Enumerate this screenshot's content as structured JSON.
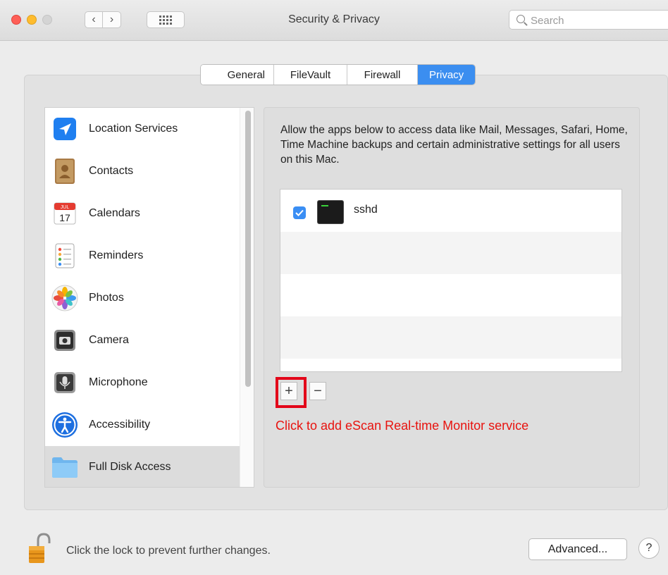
{
  "window": {
    "title": "Security & Privacy",
    "search_placeholder": "Search"
  },
  "tabs": [
    {
      "label": "General",
      "active": false
    },
    {
      "label": "FileVault",
      "active": false
    },
    {
      "label": "Firewall",
      "active": false
    },
    {
      "label": "Privacy",
      "active": true
    }
  ],
  "sidebar": {
    "items": [
      {
        "label": "Location Services",
        "icon": "location-arrow-icon"
      },
      {
        "label": "Contacts",
        "icon": "contacts-book-icon"
      },
      {
        "label": "Calendars",
        "icon": "calendar-icon",
        "icon_month": "JUL",
        "icon_day": "17"
      },
      {
        "label": "Reminders",
        "icon": "reminders-icon"
      },
      {
        "label": "Photos",
        "icon": "photos-flower-icon"
      },
      {
        "label": "Camera",
        "icon": "camera-icon"
      },
      {
        "label": "Microphone",
        "icon": "microphone-icon"
      },
      {
        "label": "Accessibility",
        "icon": "accessibility-icon"
      },
      {
        "label": "Full Disk Access",
        "icon": "folder-icon",
        "selected": true
      }
    ]
  },
  "privacy": {
    "description": "Allow the apps below to access data like Mail, Messages, Safari, Home, Time Machine backups and certain administrative settings for all users on this Mac.",
    "apps": [
      {
        "name": "sshd",
        "checked": true,
        "icon": "terminal-icon"
      }
    ],
    "add_label": "+",
    "remove_label": "−",
    "annotation": "Click to add eScan Real-time Monitor service"
  },
  "footer": {
    "lock_text": "Click the lock to prevent further changes.",
    "advanced_label": "Advanced...",
    "help_label": "?"
  },
  "colors": {
    "accent": "#3b8ef0",
    "annotation_red": "#e3061a"
  }
}
